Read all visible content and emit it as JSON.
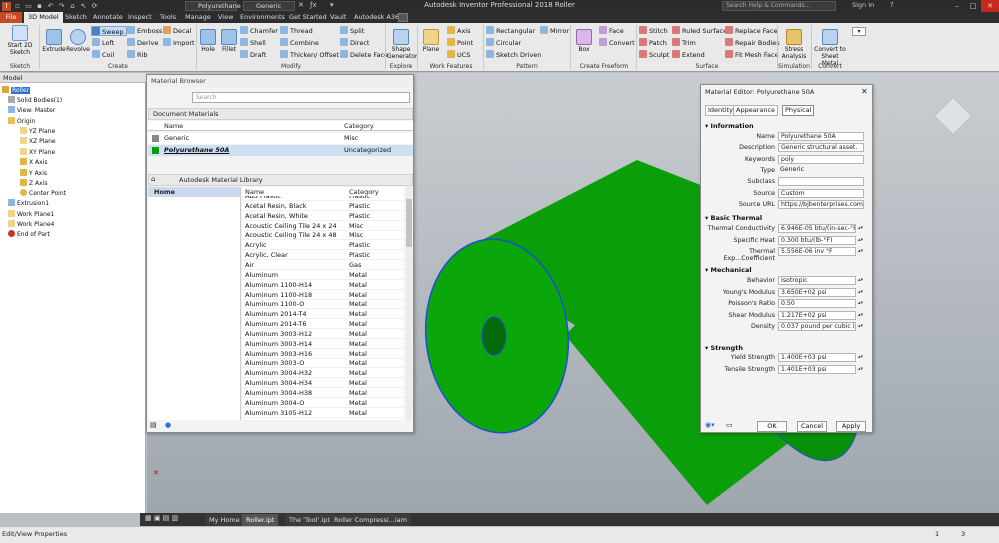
{
  "app": {
    "title": "Autodesk Inventor Professional 2018   Roller",
    "search_placeholder": "Search Help & Commands...",
    "sign_in": "Sign In",
    "material_combo": "Polyurethane",
    "appearance_combo": "Generic"
  },
  "ribbon_tabs": [
    "File",
    "3D Model",
    "Sketch",
    "Annotate",
    "Inspect",
    "Tools",
    "Manage",
    "View",
    "Environments",
    "Get Started",
    "Vault",
    "Autodesk A360"
  ],
  "ribbon": {
    "start_sketch": "Start 2D Sketch",
    "extrude": "Extrude",
    "revolve": "Revolve",
    "sweep": "Sweep",
    "loft": "Loft",
    "coil": "Coil",
    "emboss": "Emboss",
    "derive": "Derive",
    "rib": "Rib",
    "decal": "Decal",
    "import": "Import",
    "hole": "Hole",
    "fillet": "Fillet",
    "chamfer": "Chamfer",
    "shell": "Shell",
    "draft": "Draft",
    "thread": "Thread",
    "combine": "Combine",
    "thicken": "Thicken/ Offset",
    "split": "Split",
    "direct": "Direct",
    "delete_face": "Delete Face",
    "shape_generator": "Shape Generator",
    "plane": "Plane",
    "axis": "Axis",
    "point": "Point",
    "ucs": "UCS",
    "rectangular": "Rectangular",
    "circular": "Circular",
    "sketch_driven": "Sketch Driven",
    "mirror": "Mirror",
    "box": "Box",
    "face": "Face",
    "convert": "Convert",
    "stitch": "Stitch",
    "patch": "Patch",
    "sculpt": "Sculpt",
    "ruled_surface": "Ruled Surface",
    "trim": "Trim",
    "extend": "Extend",
    "replace_face": "Replace Face",
    "repair_bodies": "Repair Bodies",
    "fit_mesh_face": "Fit Mesh Face",
    "stress_analysis": "Stress Analysis",
    "convert_sheet_metal": "Convert to Sheet Metal",
    "groups": [
      "Sketch",
      "Create",
      "Modify",
      "Explore",
      "Work Features",
      "Pattern",
      "Create Freeform",
      "Surface",
      "Simulation",
      "Convert"
    ]
  },
  "model_browser": {
    "header": "Model",
    "items": [
      "Roller",
      "Solid Bodies(1)",
      "View: Master",
      "Origin",
      "YZ Plane",
      "XZ Plane",
      "XY Plane",
      "X Axis",
      "Y Axis",
      "Z Axis",
      "Center Point",
      "Extrusion1",
      "Work Plane1",
      "Work Plane4",
      "End of Part"
    ]
  },
  "material_browser": {
    "title": "Material Browser",
    "search_placeholder": "Search",
    "doc_materials": "Document Materials",
    "col_name": "Name",
    "col_category": "Category",
    "doc_rows": [
      {
        "name": "Generic",
        "category": "Misc"
      },
      {
        "name": "Polyurethane 50A",
        "category": "Uncategorized"
      }
    ],
    "library": "Autodesk Material Library",
    "home": "Home",
    "lib_rows": [
      {
        "name": "ABS Plastic",
        "category": "Plastic"
      },
      {
        "name": "Acetal Resin, Black",
        "category": "Plastic"
      },
      {
        "name": "Acetal Resin, White",
        "category": "Plastic"
      },
      {
        "name": "Acoustic Ceiling Tile 24 x 24",
        "category": "Misc"
      },
      {
        "name": "Acoustic Ceiling Tile 24 x 48",
        "category": "Misc"
      },
      {
        "name": "Acrylic",
        "category": "Plastic"
      },
      {
        "name": "Acrylic, Clear",
        "category": "Plastic"
      },
      {
        "name": "Air",
        "category": "Gas"
      },
      {
        "name": "Aluminum",
        "category": "Metal"
      },
      {
        "name": "Aluminum 1100-H14",
        "category": "Metal"
      },
      {
        "name": "Aluminum 1100-H18",
        "category": "Metal"
      },
      {
        "name": "Aluminum 1100-O",
        "category": "Metal"
      },
      {
        "name": "Aluminum 2014-T4",
        "category": "Metal"
      },
      {
        "name": "Aluminum 2014-T6",
        "category": "Metal"
      },
      {
        "name": "Aluminum 3003-H12",
        "category": "Metal"
      },
      {
        "name": "Aluminum 3003-H14",
        "category": "Metal"
      },
      {
        "name": "Aluminum 3003-H16",
        "category": "Metal"
      },
      {
        "name": "Aluminum 3003-O",
        "category": "Metal"
      },
      {
        "name": "Aluminum 3004-H32",
        "category": "Metal"
      },
      {
        "name": "Aluminum 3004-H34",
        "category": "Metal"
      },
      {
        "name": "Aluminum 3004-H38",
        "category": "Metal"
      },
      {
        "name": "Aluminum 3004-O",
        "category": "Metal"
      },
      {
        "name": "Aluminum 3105-H12",
        "category": "Metal"
      }
    ]
  },
  "material_editor": {
    "title": "Material Editor: Polyurethane 50A",
    "tabs": [
      "Identity",
      "Appearance",
      "Physical"
    ],
    "information": "Information",
    "info_rows": [
      {
        "label": "Name",
        "value": "Polyurethane 50A"
      },
      {
        "label": "Description",
        "value": "Generic structural asset."
      },
      {
        "label": "Keywords",
        "value": "poly"
      },
      {
        "label": "Type",
        "value": "Generic"
      },
      {
        "label": "Subclass",
        "value": ""
      },
      {
        "label": "Source",
        "value": "Custom"
      },
      {
        "label": "Source URL",
        "value": "https://bjbenterprises.com/..."
      }
    ],
    "basic_thermal": "Basic Thermal",
    "thermal_rows": [
      {
        "label": "Thermal Conductivity",
        "value": "6.946E-05 btu/(in-sec-°F)"
      },
      {
        "label": "Specific Heat",
        "value": "0.300 btu/(lb-°F)"
      },
      {
        "label": "Thermal Exp...Coefficient",
        "value": "5.556E-06 inv °F"
      }
    ],
    "mechanical": "Mechanical",
    "mech_rows": [
      {
        "label": "Behavior",
        "value": "Isotropic"
      },
      {
        "label": "Young's Modulus",
        "value": "3.650E+02 psi"
      },
      {
        "label": "Poisson's Ratio",
        "value": "0.50"
      },
      {
        "label": "Shear Modulus",
        "value": "1.217E+02 psi"
      },
      {
        "label": "Density",
        "value": "0.037 pound per cubic inch"
      }
    ],
    "strength": "Strength",
    "strength_rows": [
      {
        "label": "Yield Strength",
        "value": "1.400E+03 psi"
      },
      {
        "label": "Tensile Strength",
        "value": "1.401E+03 psi"
      }
    ],
    "ok": "OK",
    "cancel": "Cancel",
    "apply": "Apply"
  },
  "bottom_tabs": [
    "My Home",
    "Roller.ipt",
    "The 'Tool'.ipt",
    "Roller Compressi...iam"
  ],
  "status": {
    "text": "Edit/View Properties",
    "num1": "1",
    "num2": "3"
  },
  "colors": {
    "part_green": "#0a9e0a",
    "part_edge": "#1d4fd6",
    "file_tab": "#c64b22"
  }
}
